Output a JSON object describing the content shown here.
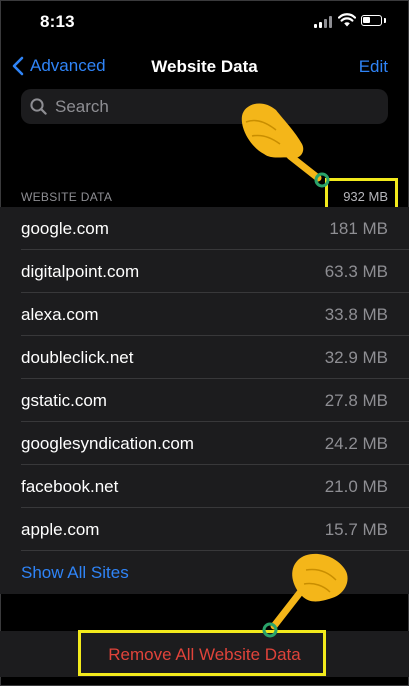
{
  "status_bar": {
    "time": "8:13"
  },
  "nav": {
    "back_label": "Advanced",
    "title": "Website Data",
    "edit_label": "Edit"
  },
  "search": {
    "placeholder": "Search"
  },
  "section": {
    "title": "WEBSITE DATA",
    "total": "932 MB"
  },
  "sites": [
    {
      "name": "google.com",
      "size": "181 MB"
    },
    {
      "name": "digitalpoint.com",
      "size": "63.3 MB"
    },
    {
      "name": "alexa.com",
      "size": "33.8 MB"
    },
    {
      "name": "doubleclick.net",
      "size": "32.9 MB"
    },
    {
      "name": "gstatic.com",
      "size": "27.8 MB"
    },
    {
      "name": "googlesyndication.com",
      "size": "24.2 MB"
    },
    {
      "name": "facebook.net",
      "size": "21.0 MB"
    },
    {
      "name": "apple.com",
      "size": "15.7 MB"
    }
  ],
  "show_all_label": "Show All Sites",
  "remove_label": "Remove All Website Data",
  "colors": {
    "accent": "#2f84f7",
    "destructive": "#e0433a",
    "highlight": "#f2ea1c",
    "pointer": "#f4b619"
  },
  "icons": {
    "back": "chevron-left-icon",
    "search": "magnifier-icon",
    "pointer": "hand-pointer-icon"
  }
}
